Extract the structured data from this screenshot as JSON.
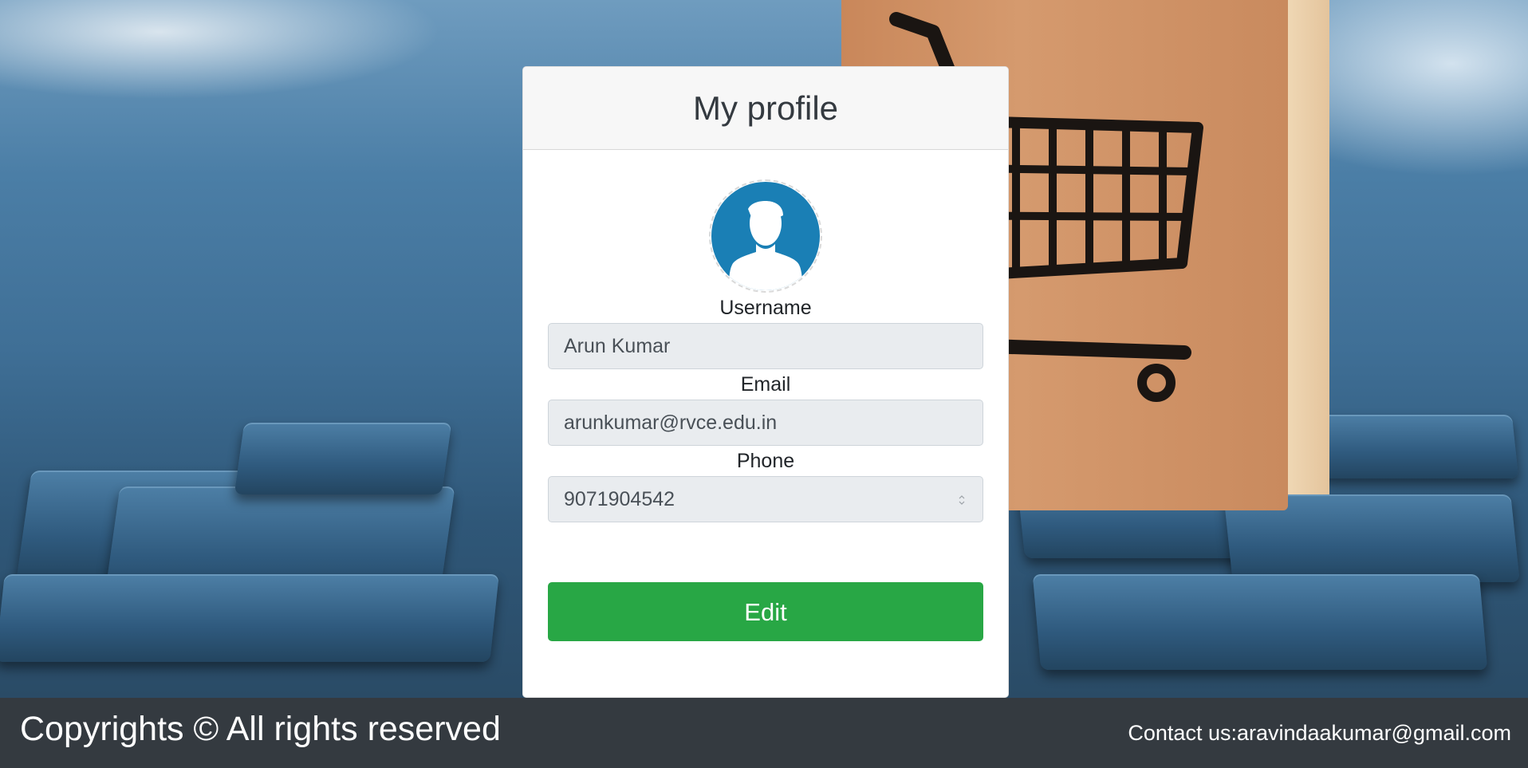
{
  "profile": {
    "title": "My profile",
    "username_label": "Username",
    "username_value": "Arun Kumar",
    "email_label": "Email",
    "email_value": "arunkumar@rvce.edu.in",
    "phone_label": "Phone",
    "phone_value": "9071904542",
    "edit_label": "Edit"
  },
  "footer": {
    "copyright": "Copyrights © All rights reserved",
    "contact": "Contact us:aravindaakumar@gmail.com"
  },
  "colors": {
    "edit_button": "#28a745",
    "footer_bg": "#343a40",
    "avatar": "#1a7fb5"
  },
  "icons": {
    "avatar": "user-avatar-icon",
    "background": "shopping-cart-icon"
  }
}
